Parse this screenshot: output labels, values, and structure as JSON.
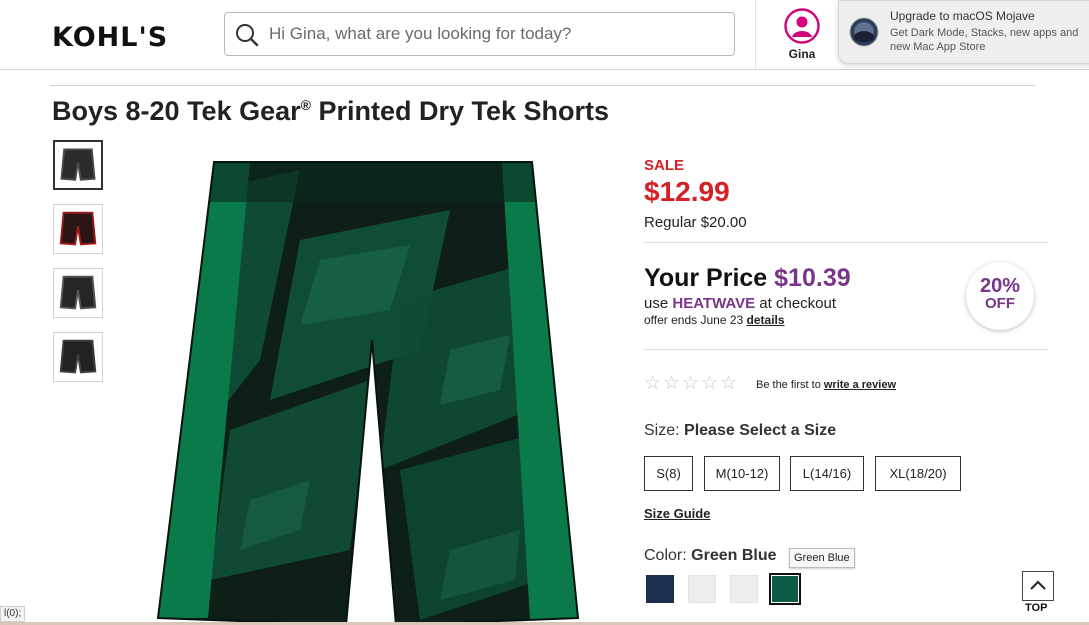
{
  "header": {
    "logo_text": "KOHL'S",
    "search_placeholder": "Hi Gina, what are you looking for today?",
    "account_name": "Gina",
    "brand_color": "#d2007a"
  },
  "notification": {
    "title": "Upgrade to macOS Mojave",
    "body": "Get Dark Mode, Stacks, new apps and new Mac App Store",
    "icon": "macos-mojave-icon"
  },
  "product": {
    "title": "Boys 8-20 Tek Gear",
    "title_mark": "®",
    "title_rest": " Printed Dry Tek Shorts",
    "thumbnails": [
      {
        "color": "#2b2b2b",
        "accent": "#4a4a4a"
      },
      {
        "color": "#2a1515",
        "accent": "#9e1b1b"
      },
      {
        "color": "#262626",
        "accent": "#555555"
      },
      {
        "color": "#222222",
        "accent": "#3e3e3e"
      }
    ]
  },
  "pricing": {
    "sale_label": "SALE",
    "sale_price": "$12.99",
    "regular_label": "Regular $20.00",
    "your_price_label": "Your Price",
    "your_price_value": "$10.39",
    "promo_prefix": "use ",
    "promo_code": "HEATWAVE",
    "promo_suffix": " at checkout",
    "offer_text": "offer ends June 23 ",
    "details_link": "details",
    "badge_percent": "20%",
    "badge_off": "OFF",
    "sale_color": "#d61f26",
    "promo_color": "#78358a"
  },
  "reviews": {
    "rating": 0,
    "max_rating": 5,
    "prefix": "Be the first to ",
    "link": "write a review"
  },
  "size": {
    "label": "Size:",
    "value": "Please Select a Size",
    "options": [
      "S(8)",
      "M(10-12)",
      "L(14/16)",
      "XL(18/20)"
    ],
    "guide_link": "Size Guide"
  },
  "color": {
    "label": "Color:",
    "value": "Green Blue",
    "tooltip": "Green Blue",
    "swatches": [
      {
        "color": "#1d2f4c",
        "selected": false
      },
      {
        "color": "#ededed",
        "selected": false
      },
      {
        "color": "#ededed",
        "selected": false
      },
      {
        "color": "#0f5b4a",
        "selected": true
      }
    ]
  },
  "back_to_top": "TOP",
  "status_text": "l(0);"
}
